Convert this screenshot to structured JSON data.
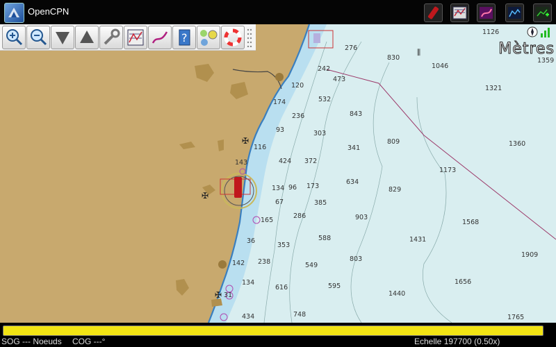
{
  "app": {
    "title": "OpenCPN"
  },
  "titlebar": {
    "right_icons": [
      "route-icon",
      "chart-settings-icon",
      "tracks-icon",
      "tide-icon",
      "add-chart-icon"
    ]
  },
  "toolbar": {
    "tools": [
      "zoom-in-icon",
      "zoom-out-icon",
      "scale-down-icon",
      "scale-up-icon",
      "settings-icon",
      "route-manager-icon",
      "tracks-icon",
      "help-icon",
      "ais-icon",
      "lifebuoy-icon"
    ]
  },
  "chart": {
    "units_label": "Mètres",
    "colors": {
      "land": "#c8a96e",
      "shallow": "#b9dff0",
      "sea": "#d9eef0",
      "coast": "#3a7fbf",
      "route": "#9c3a6a"
    },
    "depths": [
      {
        "v": "1126"
      },
      {
        "v": "276"
      },
      {
        "v": "830"
      },
      {
        "v": "1046"
      },
      {
        "v": "1359"
      },
      {
        "v": "242"
      },
      {
        "v": "473"
      },
      {
        "v": "120"
      },
      {
        "v": "1321"
      },
      {
        "v": "532"
      },
      {
        "v": "174"
      },
      {
        "v": "843"
      },
      {
        "v": "236"
      },
      {
        "v": "93"
      },
      {
        "v": "303"
      },
      {
        "v": "809"
      },
      {
        "v": "1360"
      },
      {
        "v": "116"
      },
      {
        "v": "341"
      },
      {
        "v": "424"
      },
      {
        "v": "372"
      },
      {
        "v": "1173"
      },
      {
        "v": "143"
      },
      {
        "v": "634"
      },
      {
        "v": "134"
      },
      {
        "v": "96"
      },
      {
        "v": "173"
      },
      {
        "v": "829"
      },
      {
        "v": "67"
      },
      {
        "v": "385"
      },
      {
        "v": "165"
      },
      {
        "v": "286"
      },
      {
        "v": "903"
      },
      {
        "v": "1568"
      },
      {
        "v": "36"
      },
      {
        "v": "588"
      },
      {
        "v": "1431"
      },
      {
        "v": "353"
      },
      {
        "v": "1909"
      },
      {
        "v": "238"
      },
      {
        "v": "803"
      },
      {
        "v": "142"
      },
      {
        "v": "549"
      },
      {
        "v": "134"
      },
      {
        "v": "1656"
      },
      {
        "v": "616"
      },
      {
        "v": "595"
      },
      {
        "v": "1440"
      },
      {
        "v": "31"
      },
      {
        "v": "434"
      },
      {
        "v": "748"
      },
      {
        "v": "1765"
      }
    ]
  },
  "status": {
    "progress": 1.0,
    "sog": "SOG --- Noeuds",
    "cog": "COG ---°",
    "scale": "Echelle 197700 (0.50x)"
  }
}
